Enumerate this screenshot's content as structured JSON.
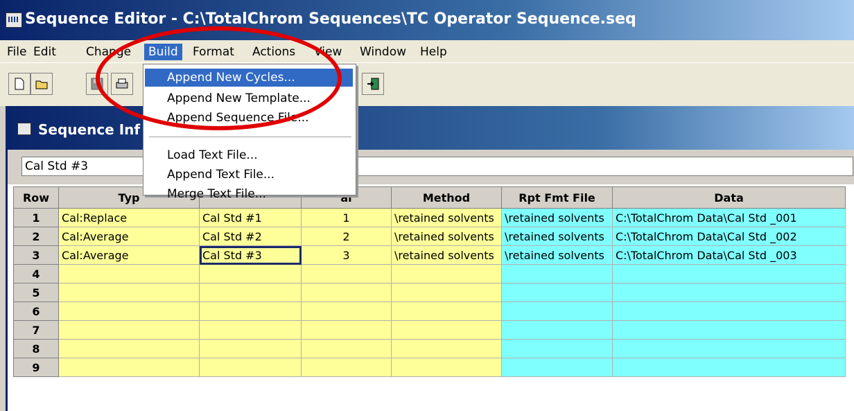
{
  "window": {
    "title": "Sequence Editor - C:\\TotalChrom Sequences\\TC Operator Sequence.seq"
  },
  "menubar": [
    "File",
    "Edit",
    "Change",
    "Build",
    "Format",
    "Actions",
    "View",
    "Window",
    "Help"
  ],
  "active_menu": "Build",
  "build_menu": {
    "items": [
      {
        "label": "Append New Cycles...",
        "highlighted": true
      },
      {
        "label": "Append New Template..."
      },
      {
        "label": "Append Sequence File..."
      },
      {
        "label": "Load Text File..."
      },
      {
        "label": "Append Text File..."
      },
      {
        "label": "Merge Text File..."
      }
    ]
  },
  "child": {
    "title": "Sequence Inf",
    "cell_editor_value": "Cal Std #3"
  },
  "grid": {
    "headers": [
      "Row",
      "Typ",
      "",
      "al",
      "Method",
      "Rpt Fmt File",
      "Data"
    ],
    "rows": [
      [
        "1",
        "Cal:Replace",
        "Cal Std #1",
        "1",
        "\\retained solvents",
        "\\retained solvents",
        "C:\\TotalChrom Data\\Cal Std _001"
      ],
      [
        "2",
        "Cal:Average",
        "Cal Std #2",
        "2",
        "\\retained solvents",
        "\\retained solvents",
        "C:\\TotalChrom Data\\Cal Std _002"
      ],
      [
        "3",
        "Cal:Average",
        "Cal Std #3",
        "3",
        "\\retained solvents",
        "\\retained solvents",
        "C:\\TotalChrom Data\\Cal Std _003"
      ],
      [
        "4",
        "",
        "",
        "",
        "",
        "",
        ""
      ],
      [
        "5",
        "",
        "",
        "",
        "",
        "",
        ""
      ],
      [
        "6",
        "",
        "",
        "",
        "",
        "",
        ""
      ],
      [
        "7",
        "",
        "",
        "",
        "",
        "",
        ""
      ],
      [
        "8",
        "",
        "",
        "",
        "",
        "",
        ""
      ],
      [
        "9",
        "",
        "",
        "",
        "",
        "",
        ""
      ]
    ],
    "selected_cell": "Cal Std #3"
  },
  "colors": {
    "yellow_cells": "#ffff99",
    "cyan_cells": "#80ffff",
    "highlight": "#316ac5",
    "annotation": "#e00000"
  },
  "icons": [
    "new-file-icon",
    "open-folder-icon",
    "save-icon",
    "print-icon",
    "exit-icon"
  ]
}
